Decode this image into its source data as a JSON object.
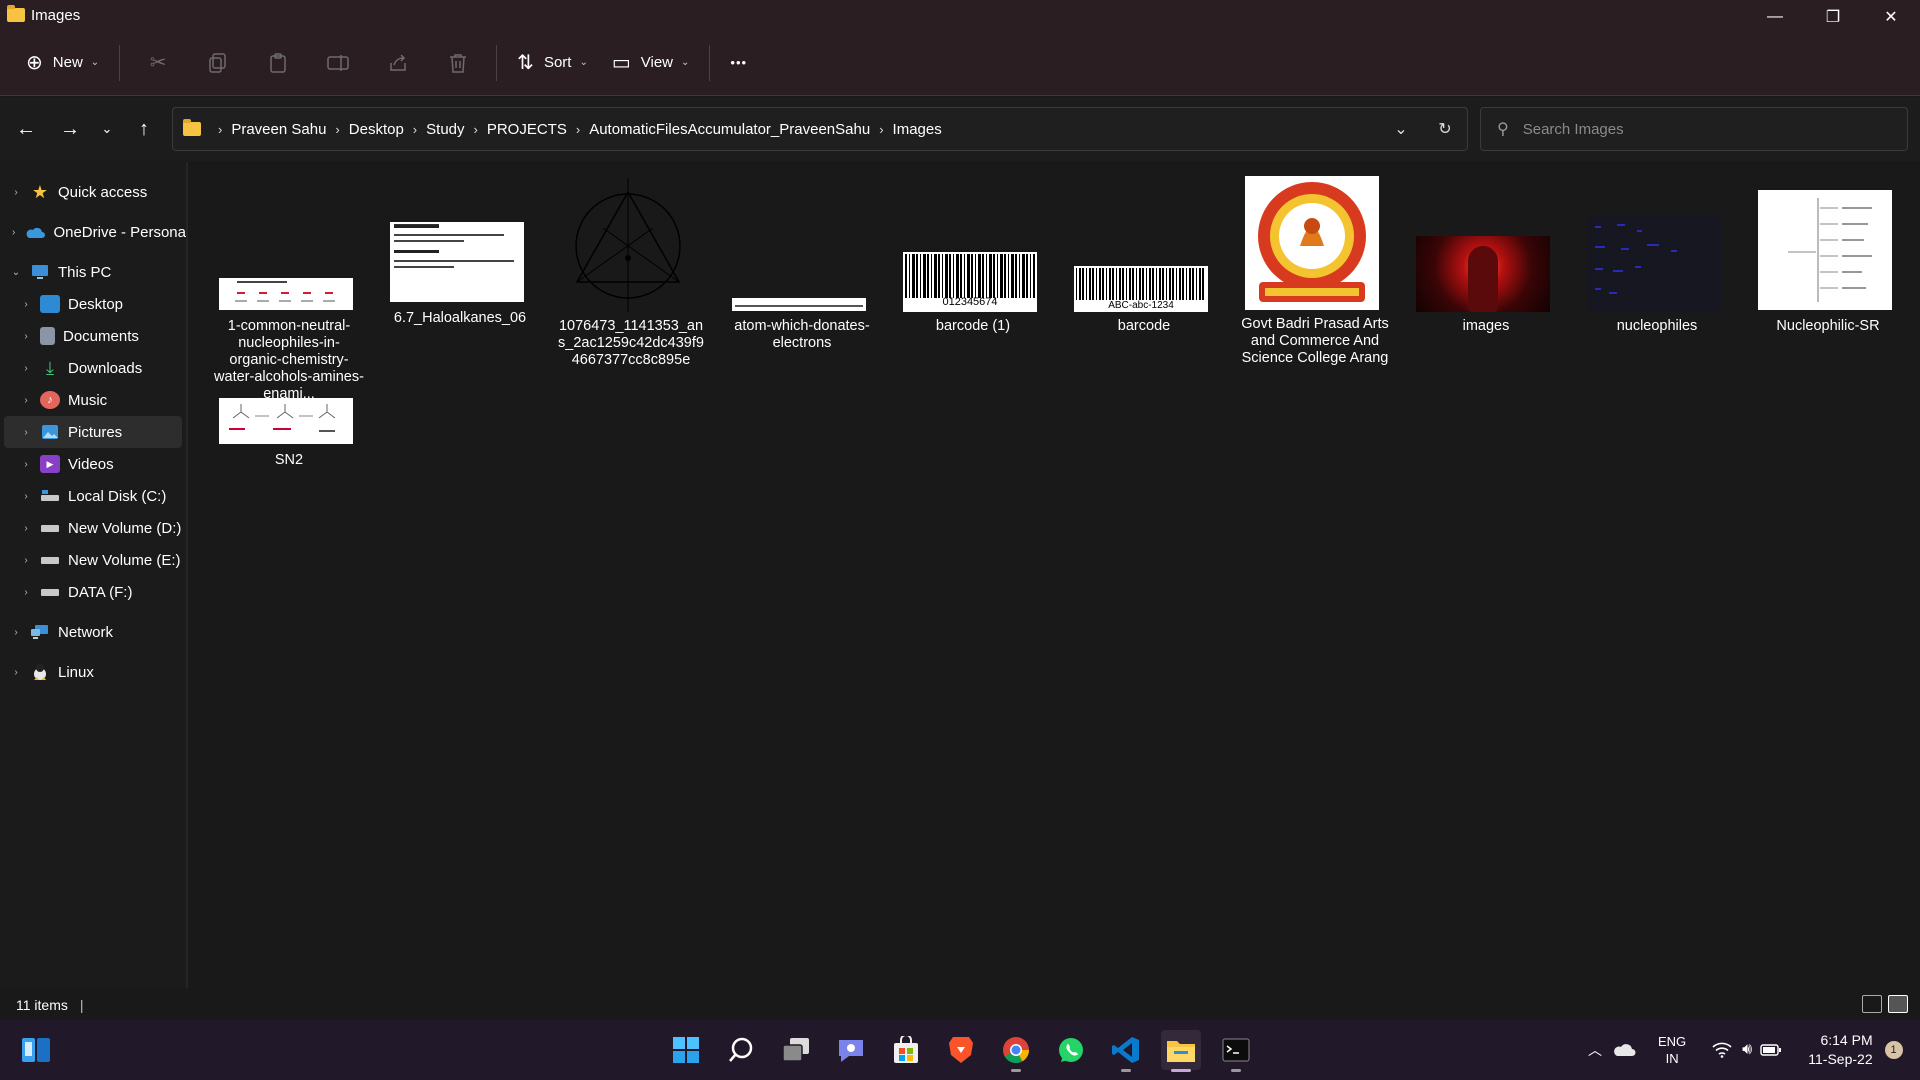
{
  "window": {
    "title": "Images",
    "minimize": "—",
    "maximize": "❐",
    "close": "✕"
  },
  "toolbar": {
    "new_label": "New",
    "sort_label": "Sort",
    "view_label": "View",
    "more_label": "•••"
  },
  "address": {
    "breadcrumbs": [
      "Praveen Sahu",
      "Desktop",
      "Study",
      "PROJECTS",
      "AutomaticFilesAccumulator_PraveenSahu",
      "Images"
    ]
  },
  "search": {
    "placeholder": "Search Images"
  },
  "sidebar": {
    "items": [
      {
        "label": "Quick access",
        "icon": "star-icon"
      },
      {
        "label": "OneDrive - Persona",
        "icon": "cloud-icon"
      },
      {
        "label": "This PC",
        "icon": "pc-icon"
      },
      {
        "label": "Desktop",
        "icon": "desktop-icon"
      },
      {
        "label": "Documents",
        "icon": "documents-icon"
      },
      {
        "label": "Downloads",
        "icon": "download-icon"
      },
      {
        "label": "Music",
        "icon": "music-icon"
      },
      {
        "label": "Pictures",
        "icon": "pictures-icon"
      },
      {
        "label": "Videos",
        "icon": "videos-icon"
      },
      {
        "label": "Local Disk (C:)",
        "icon": "drive-icon"
      },
      {
        "label": "New Volume (D:)",
        "icon": "drive-icon"
      },
      {
        "label": "New Volume (E:)",
        "icon": "drive-icon"
      },
      {
        "label": "DATA (F:)",
        "icon": "drive-icon"
      },
      {
        "label": "Network",
        "icon": "network-icon"
      },
      {
        "label": "Linux",
        "icon": "linux-icon"
      }
    ]
  },
  "files": [
    {
      "name": "1-common-neutral-nucleophiles-in-organic-chemistry-water-alcohols-amines-enami..."
    },
    {
      "name": "6.7_Haloalkanes_06"
    },
    {
      "name": "1076473_1141353_ans_2ac1259c42dc439f94667377cc8c895e"
    },
    {
      "name": "atom-which-donates-electrons"
    },
    {
      "name": "barcode (1)",
      "code": "012345674"
    },
    {
      "name": "barcode",
      "code": "ABC-abc-1234"
    },
    {
      "name": "Govt Badri Prasad Arts and Commerce And Science College Arang"
    },
    {
      "name": "images"
    },
    {
      "name": "nucleophiles"
    },
    {
      "name": "Nucleophilic-SR"
    },
    {
      "name": "SN2"
    }
  ],
  "status": {
    "count": "11 items"
  },
  "taskbar": {
    "lang_top": "ENG",
    "lang_bottom": "IN",
    "time": "6:14 PM",
    "date": "11-Sep-22",
    "notification_count": "1"
  },
  "colors": {
    "background": "#191919",
    "titlebar": "#2a1e22",
    "taskbar": "#21182a",
    "folder": "#f6c343"
  }
}
